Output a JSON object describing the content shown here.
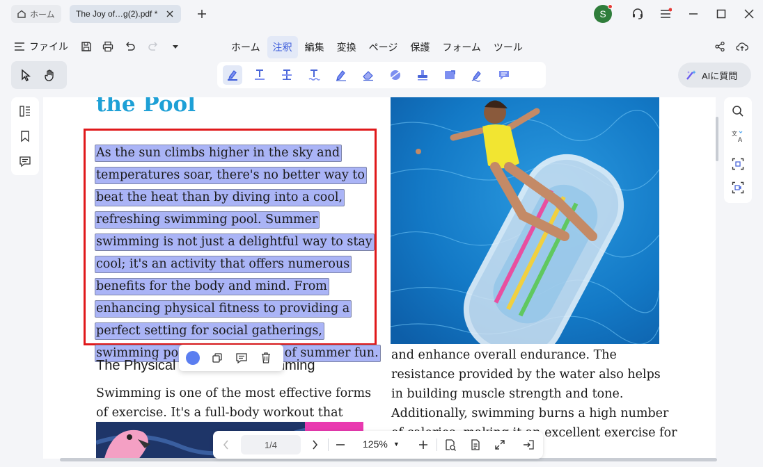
{
  "tabs": {
    "home_label": "ホーム",
    "doc_label": "The Joy of…g(2).pdf *"
  },
  "user": {
    "avatar_letter": "S"
  },
  "menubar": {
    "file_label": "ファイル",
    "menus": [
      "ホーム",
      "注釈",
      "編集",
      "変換",
      "ページ",
      "保護",
      "フォーム",
      "ツール"
    ],
    "active_menu": "注釈"
  },
  "ai": {
    "label": "AIに質問"
  },
  "document": {
    "title": "the Pool",
    "selected_lines": [
      "As the sun climbs higher in the sky and",
      "temperatures soar, there's no better way to",
      "beat the heat than by diving into a cool,",
      "refreshing swimming pool. Summer",
      "swimming is not just a delightful way to stay",
      "cool; it's an activity that offers numerous",
      "benefits for the body and mind. From",
      "enhancing physical fitness to providing a",
      "perfect setting for social gatherings,",
      "swimming pools are the heart of summer fun."
    ],
    "subheading_start": "The Physical",
    "subheading_end": "mming",
    "left_body": [
      "Swimming is one of the most effective forms",
      "of exercise. It's a full-body workout that"
    ],
    "right_body": [
      "and enhance overall endurance. The",
      "resistance provided by the water also helps",
      "in building muscle strength and tone.",
      "Additionally, swimming burns a high number",
      "of calories, making it an excellent exercise for"
    ]
  },
  "colors": {
    "highlight": "#aab4f6",
    "selection_border": "#e0191b",
    "title": "#1ea0d6",
    "accent": "#3b5bdb"
  },
  "pagenav": {
    "page": "1/4",
    "zoom": "125%"
  }
}
